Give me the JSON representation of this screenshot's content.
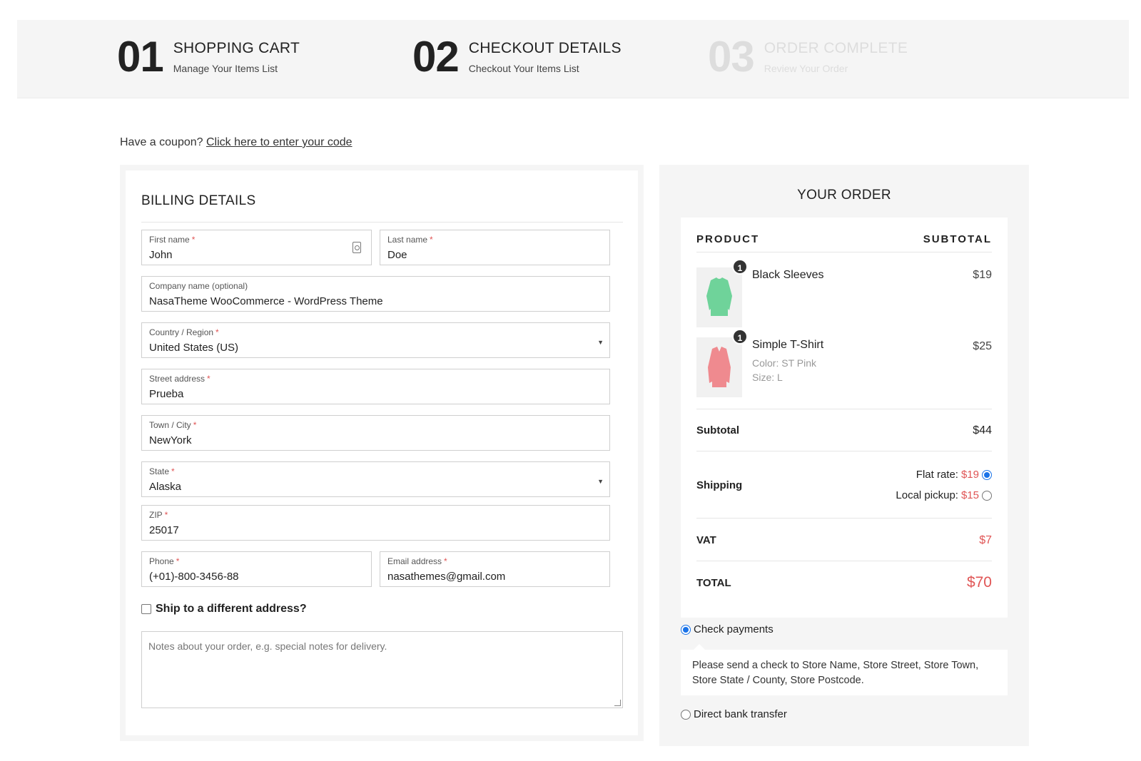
{
  "steps": [
    {
      "num": "01",
      "title": "SHOPPING CART",
      "subtitle": "Manage Your Items List"
    },
    {
      "num": "02",
      "title": "CHECKOUT DETAILS",
      "subtitle": "Checkout Your Items List"
    },
    {
      "num": "03",
      "title": "ORDER COMPLETE",
      "subtitle": "Review Your Order"
    }
  ],
  "coupon": {
    "prompt": "Have a coupon?",
    "link": "Click here to enter your code"
  },
  "billing": {
    "title": "BILLING DETAILS",
    "required_mark": "*",
    "first_name": {
      "label": "First name",
      "value": "John"
    },
    "last_name": {
      "label": "Last name",
      "value": "Doe"
    },
    "company": {
      "label": "Company name (optional)",
      "value": "NasaTheme WooCommerce - WordPress Theme"
    },
    "country": {
      "label": "Country / Region",
      "value": "United States (US)"
    },
    "street": {
      "label": "Street address",
      "value": "Prueba"
    },
    "city": {
      "label": "Town / City",
      "value": "NewYork"
    },
    "state": {
      "label": "State",
      "value": "Alaska"
    },
    "zip": {
      "label": "ZIP",
      "value": "25017"
    },
    "phone": {
      "label": "Phone",
      "value": "(+01)-800-3456-88"
    },
    "email": {
      "label": "Email address",
      "value": "nasathemes@gmail.com"
    },
    "ship_different": "Ship to a different address?",
    "notes_placeholder": "Notes about your order, e.g. special notes for delivery."
  },
  "order": {
    "title": "YOUR ORDER",
    "col_product": "PRODUCT",
    "col_subtotal": "SUBTOTAL",
    "items": [
      {
        "qty": "1",
        "name": "Black Sleeves",
        "price": "$19",
        "color": "#6fd39a"
      },
      {
        "qty": "1",
        "name": "Simple T-Shirt",
        "price": "$25",
        "color": "#ef8a8f",
        "meta_color_label": "Color:",
        "meta_color": "ST Pink",
        "meta_size_label": "Size:",
        "meta_size": "L"
      }
    ],
    "subtotal_label": "Subtotal",
    "subtotal_value": "$44",
    "shipping_label": "Shipping",
    "shipping_options": [
      {
        "label": "Flat rate:",
        "price": "$19",
        "selected": true
      },
      {
        "label": "Local pickup:",
        "price": "$15",
        "selected": false
      }
    ],
    "vat_label": "VAT",
    "vat_value": "$7",
    "total_label": "TOTAL",
    "total_value": "$70"
  },
  "payment": {
    "options": [
      {
        "label": "Check payments",
        "selected": true
      },
      {
        "label": "Direct bank transfer",
        "selected": false
      }
    ],
    "check_description": "Please send a check to Store Name, Store Street, Store Town, Store State / County, Store Postcode."
  },
  "colors": {
    "accent_red": "#e05555",
    "radio_blue": "#1a73e8",
    "panel_bg": "#f5f5f5"
  }
}
